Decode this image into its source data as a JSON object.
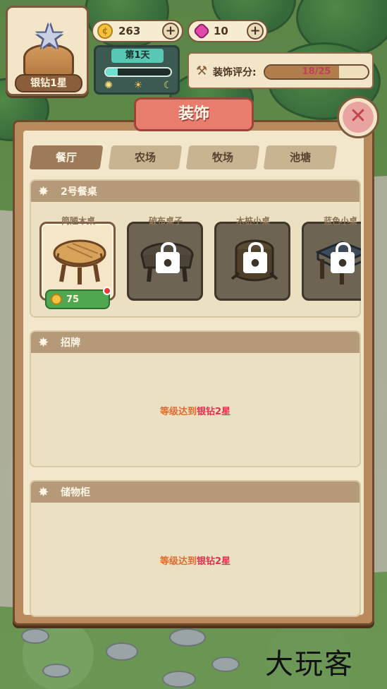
{
  "hud": {
    "rank_label": "银钻1星",
    "coins": "263",
    "gems": "10",
    "day_label": "第1天",
    "day_progress": 0.18,
    "score_label": "装饰评分:",
    "score_value": "18/25",
    "score_progress": 0.72
  },
  "panel": {
    "title": "装饰",
    "tabs": [
      {
        "label": "餐厅",
        "active": true
      },
      {
        "label": "农场",
        "active": false
      },
      {
        "label": "牧场",
        "active": false
      },
      {
        "label": "池塘",
        "active": false
      }
    ]
  },
  "sections": {
    "table": {
      "title": "2号餐桌",
      "items": [
        {
          "name": "简陋木桌",
          "price": "75",
          "locked": false,
          "selected": true
        },
        {
          "name": "破布桌子",
          "locked": true
        },
        {
          "name": "木桩小桌",
          "locked": true
        },
        {
          "name": "蓝色小桌",
          "locked": true
        }
      ]
    },
    "sign": {
      "title": "招牌",
      "lock_prefix": "等级达到",
      "lock_level": "银钻2星"
    },
    "cabinet": {
      "title": "储物柜",
      "lock_prefix": "等级达到",
      "lock_level": "银钻2星"
    }
  },
  "watermark": "大玩客",
  "colors": {
    "accent_red": "#e87c6d",
    "coin_gold": "#f3c23f",
    "gem_pink": "#e14aa8",
    "locked_level_red": "#e0314f"
  }
}
